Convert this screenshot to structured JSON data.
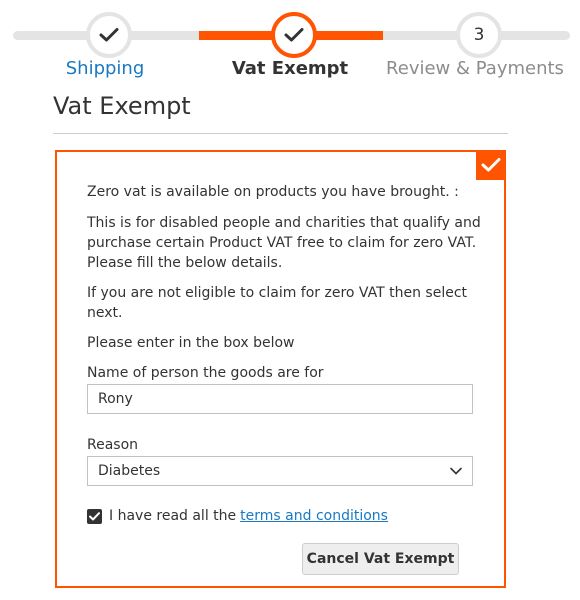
{
  "progress": {
    "steps": [
      {
        "label": "Shipping",
        "state": "complete"
      },
      {
        "label": "Vat Exempt",
        "state": "active-complete"
      },
      {
        "label": "Review & Payments",
        "number": "3",
        "state": "upcoming"
      }
    ]
  },
  "page_title": "Vat Exempt",
  "form": {
    "intro": "Zero vat is available on products you have brought. :",
    "description": "This is for disabled people and charities that qualify and purchase certain Product VAT free to claim for zero VAT. Please fill the below details.",
    "not_eligible": "If you are not eligible to claim for zero VAT then select next.",
    "instructions": "Please enter in the box below",
    "name_label": "Name of person the goods are for",
    "name_value": "Rony",
    "reason_label": "Reason",
    "reason_value": "Diabetes",
    "terms_prefix": "I have read all the",
    "terms_link": "terms and conditions",
    "terms_checked": true,
    "cancel_button": "Cancel Vat Exempt"
  },
  "colors": {
    "accent": "#ff5501",
    "link": "#1979c3",
    "track": "#e4e4e4"
  }
}
